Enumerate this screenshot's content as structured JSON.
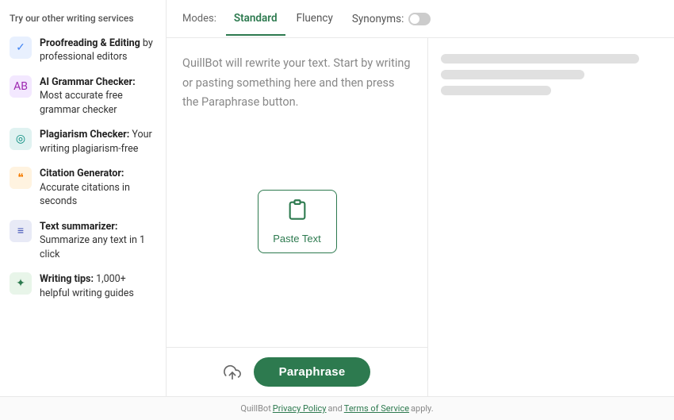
{
  "sidebar": {
    "title": "Try our other writing services",
    "items": [
      {
        "id": "proofreading",
        "label_bold": "Proofreading & Editing",
        "label_rest": " by professional editors",
        "icon": "✓",
        "icon_color": "icon-blue"
      },
      {
        "id": "grammar",
        "label_bold": "AI Grammar Checker:",
        "label_rest": " Most accurate free grammar checker",
        "icon": "AB",
        "icon_color": "icon-purple"
      },
      {
        "id": "plagiarism",
        "label_bold": "Plagiarism Checker:",
        "label_rest": " Your writing plagiarism-free",
        "icon": "◎",
        "icon_color": "icon-teal"
      },
      {
        "id": "citation",
        "label_bold": "Citation Generator:",
        "label_rest": " Accurate citations in seconds",
        "icon": "❝",
        "icon_color": "icon-orange"
      },
      {
        "id": "summarizer",
        "label_bold": "Text summarizer:",
        "label_rest": " Summarize any text in 1 click",
        "icon": "≡",
        "icon_color": "icon-indigo"
      },
      {
        "id": "tips",
        "label_bold": "Writing tips:",
        "label_rest": " 1,000+ helpful writing guides",
        "icon": "✦",
        "icon_color": "icon-green"
      }
    ]
  },
  "tabs": {
    "label": "Modes:",
    "items": [
      {
        "id": "standard",
        "label": "Standard",
        "active": true
      },
      {
        "id": "fluency",
        "label": "Fluency",
        "active": false
      },
      {
        "id": "synonyms",
        "label": "Synonyms:",
        "active": false
      }
    ]
  },
  "editor": {
    "placeholder": "QuillBot will rewrite your text. Start by writing or pasting something here and then press the Paraphrase button.",
    "paste_label": "Paste Text",
    "paraphrase_label": "Paraphrase"
  },
  "footer": {
    "text_before": "QuillBot ",
    "privacy_label": "Privacy Policy",
    "text_mid": " and ",
    "terms_label": "Terms of Service",
    "text_after": " apply."
  }
}
